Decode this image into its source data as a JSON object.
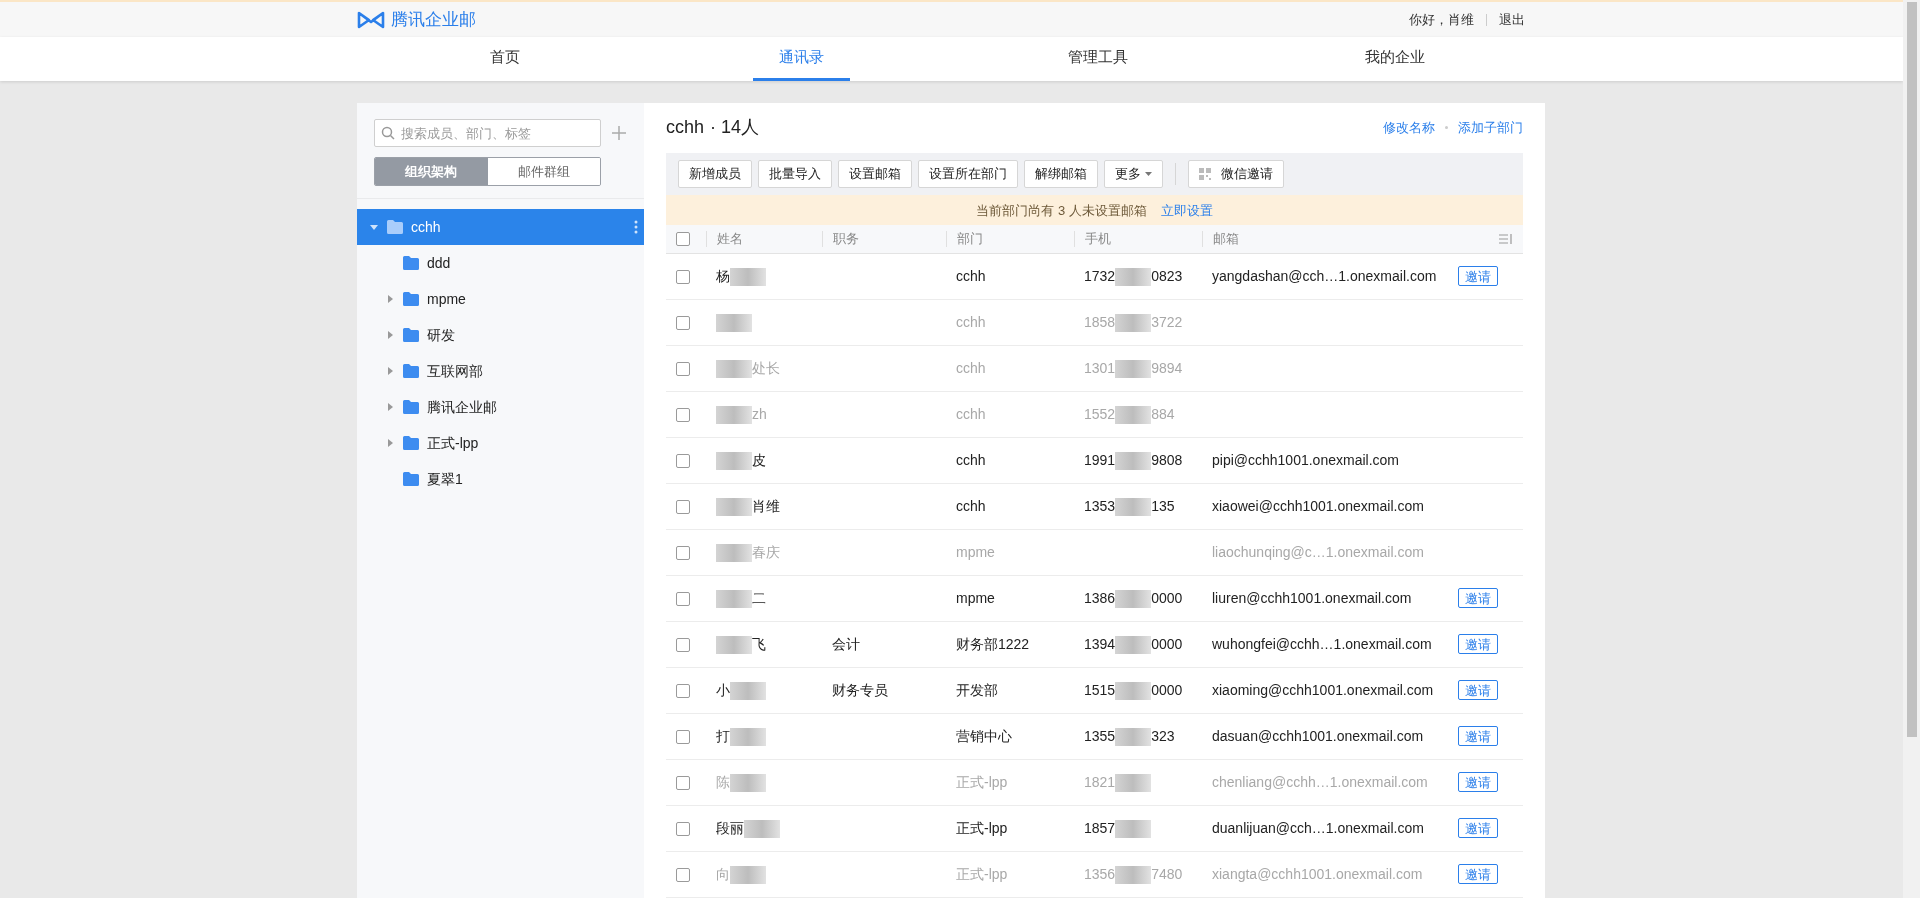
{
  "header": {
    "logo": "腾讯企业邮",
    "greeting": "你好，肖维",
    "logout": "退出"
  },
  "nav": [
    {
      "label": "首页",
      "selected": false
    },
    {
      "label": "通讯录",
      "selected": true
    },
    {
      "label": "管理工具",
      "selected": false
    },
    {
      "label": "我的企业",
      "selected": false
    }
  ],
  "sidebar": {
    "search": {
      "placeholder": "搜索成员、部门、标签"
    },
    "tabs": [
      {
        "label": "组织架构",
        "selected": true
      },
      {
        "label": "邮件群组",
        "selected": false
      }
    ],
    "tree": [
      {
        "label": "cchh",
        "selected": true,
        "expanded": true,
        "children": [
          {
            "label": "ddd",
            "selected": false,
            "expanded": false,
            "has_children": false
          },
          {
            "label": "mpme",
            "selected": false,
            "expanded": false,
            "has_children": true
          },
          {
            "label": "研发",
            "selected": false,
            "expanded": false,
            "has_children": true
          },
          {
            "label": "互联网部",
            "selected": false,
            "expanded": false,
            "has_children": true
          },
          {
            "label": "腾讯企业邮",
            "selected": false,
            "expanded": false,
            "has_children": true
          },
          {
            "label": "正式-lpp",
            "selected": false,
            "expanded": false,
            "has_children": true
          },
          {
            "label": "夏翠1",
            "selected": false,
            "expanded": false,
            "has_children": false
          }
        ]
      }
    ]
  },
  "department": {
    "name": "cchh",
    "count": "· 14人",
    "links": [
      "修改名称",
      "添加子部门"
    ]
  },
  "toolbar": [
    {
      "label": "新增成员",
      "kind": "plain"
    },
    {
      "label": "批量导入",
      "kind": "plain"
    },
    {
      "label": "设置邮箱",
      "kind": "plain"
    },
    {
      "label": "设置所在部门",
      "kind": "plain"
    },
    {
      "label": "解绑邮箱",
      "kind": "plain"
    },
    {
      "label": "更多",
      "kind": "dropdown"
    },
    {
      "label": "微信邀请",
      "kind": "qr"
    }
  ],
  "notice": {
    "text": "当前部门尚有 3 人未设置邮箱",
    "link": "立即设置"
  },
  "table": {
    "checked": false,
    "columns": [
      "姓名",
      "职务",
      "部门",
      "手机",
      "邮箱"
    ],
    "rows": [
      {
        "name": "杨",
        "blur_before": false,
        "blur_after": true,
        "title": "",
        "dept": "cchh",
        "phone_start": "1732",
        "phone_end": "0823",
        "email": "yangdashan@cch…1.onexmail.com",
        "invite": "邀请",
        "disabled": false,
        "checked": false
      },
      {
        "name": "",
        "blur_before": true,
        "blur_after": false,
        "title": "",
        "dept": "cchh",
        "phone_start": "1858",
        "phone_end": "3722",
        "email": "",
        "invite": "",
        "disabled": true,
        "checked": false
      },
      {
        "name": "处长",
        "blur_before": true,
        "blur_after": false,
        "title": "",
        "dept": "cchh",
        "phone_start": "1301",
        "phone_end": "9894",
        "email": "",
        "invite": "",
        "disabled": true,
        "checked": false
      },
      {
        "name": "zh",
        "blur_before": true,
        "blur_after": false,
        "title": "",
        "dept": "cchh",
        "phone_start": "1552",
        "phone_end": "884",
        "email": "",
        "invite": "",
        "disabled": true,
        "checked": false
      },
      {
        "name": "皮",
        "blur_before": true,
        "blur_after": false,
        "title": "",
        "dept": "cchh",
        "phone_start": "1991",
        "phone_end": "9808",
        "email": "pipi@cchh1001.onexmail.com",
        "invite": "",
        "disabled": false,
        "checked": false
      },
      {
        "name": "肖维",
        "blur_before": true,
        "blur_after": false,
        "title": "",
        "dept": "cchh",
        "phone_start": "1353",
        "phone_end": "135",
        "email": "xiaowei@cchh1001.onexmail.com",
        "invite": "",
        "disabled": false,
        "checked": false
      },
      {
        "name": "春庆",
        "blur_before": true,
        "blur_after": false,
        "title": "",
        "dept": "mpme",
        "phone_start": "",
        "phone_end": "",
        "email": "liaochunqing@c…1.onexmail.com",
        "invite": "",
        "disabled": true,
        "checked": false
      },
      {
        "name": "二",
        "blur_before": true,
        "blur_after": false,
        "title": "",
        "dept": "mpme",
        "phone_start": "1386",
        "phone_end": "0000",
        "email": "liuren@cchh1001.onexmail.com",
        "invite": "邀请",
        "disabled": false,
        "checked": false
      },
      {
        "name": "飞",
        "blur_before": true,
        "blur_after": false,
        "title": "会计",
        "dept": "财务部1222",
        "phone_start": "1394",
        "phone_end": "0000",
        "email": "wuhongfei@cchh…1.onexmail.com",
        "invite": "邀请",
        "disabled": false,
        "checked": false
      },
      {
        "name": "小",
        "blur_before": false,
        "blur_after": true,
        "title": "财务专员",
        "dept": "开发部",
        "phone_start": "1515",
        "phone_end": "0000",
        "email": "xiaoming@cchh1001.onexmail.com",
        "invite": "邀请",
        "disabled": false,
        "checked": false
      },
      {
        "name": "打",
        "blur_before": false,
        "blur_after": true,
        "title": "",
        "dept": "营销中心",
        "phone_start": "1355",
        "phone_end": "323",
        "email": "dasuan@cchh1001.onexmail.com",
        "invite": "邀请",
        "disabled": false,
        "checked": false
      },
      {
        "name": "陈",
        "blur_before": false,
        "blur_after": true,
        "title": "",
        "dept": "正式-lpp",
        "phone_start": "1821",
        "phone_end": "",
        "email": "chenliang@cchh…1.onexmail.com",
        "invite": "邀请",
        "disabled": true,
        "checked": false
      },
      {
        "name": "段丽",
        "blur_before": false,
        "blur_after": true,
        "title": "",
        "dept": "正式-lpp",
        "phone_start": "1857",
        "phone_end": "",
        "email": "duanlijuan@cch…1.onexmail.com",
        "invite": "邀请",
        "disabled": false,
        "checked": false
      },
      {
        "name": "向",
        "blur_before": false,
        "blur_after": true,
        "title": "",
        "dept": "正式-lpp",
        "phone_start": "1356",
        "phone_end": "7480",
        "email": "xiangta@cchh1001.onexmail.com",
        "invite": "邀请",
        "disabled": true,
        "checked": false
      }
    ]
  }
}
